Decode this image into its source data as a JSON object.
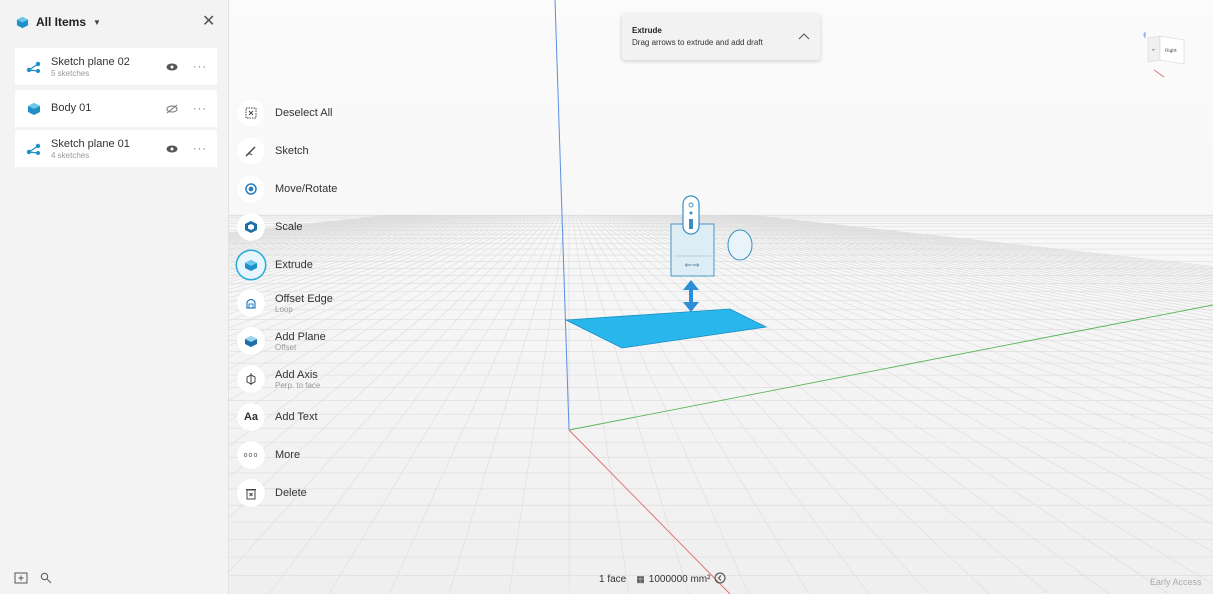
{
  "panel": {
    "title": "All Items",
    "items": [
      {
        "name": "Sketch plane 02",
        "sub": "5 sketches"
      },
      {
        "name": "Body 01",
        "sub": ""
      },
      {
        "name": "Sketch plane 01",
        "sub": "4 sketches"
      }
    ],
    "more_label": "···"
  },
  "tools": [
    {
      "label": "Deselect All",
      "sub": ""
    },
    {
      "label": "Sketch",
      "sub": ""
    },
    {
      "label": "Move/Rotate",
      "sub": ""
    },
    {
      "label": "Scale",
      "sub": ""
    },
    {
      "label": "Extrude",
      "sub": ""
    },
    {
      "label": "Offset Edge",
      "sub": "Loop"
    },
    {
      "label": "Add Plane",
      "sub": "Offset"
    },
    {
      "label": "Add Axis",
      "sub": "Perp. to face"
    },
    {
      "label": "Add Text",
      "sub": ""
    },
    {
      "label": "More",
      "sub": ""
    },
    {
      "label": "Delete",
      "sub": ""
    }
  ],
  "text_icon_glyph": "Aa",
  "more_icon_glyph": "ooo",
  "tooltip": {
    "title": "Extrude",
    "desc": "Drag arrows to extrude and add draft"
  },
  "status": {
    "face_count": "1 face",
    "area": "1000000 mm²"
  },
  "early_access": "Early Access",
  "view_cube": {
    "face_label": "Right"
  },
  "colors": {
    "accent": "#2aa8d8",
    "face_fill": "#29b6ec",
    "axis_x": "#e06a6a",
    "axis_y": "#5ab55a",
    "axis_z": "#5b8ee8"
  },
  "icons": {
    "header": "cube-icon",
    "close": "close-icon",
    "sketch_plane": "sketch-plane-icon",
    "body": "body-cube-icon",
    "visible": "eye-icon",
    "hidden": "eye-off-icon",
    "add_folder": "add-folder-icon",
    "search": "search-icon",
    "zoom": "zoom-fit-icon"
  }
}
